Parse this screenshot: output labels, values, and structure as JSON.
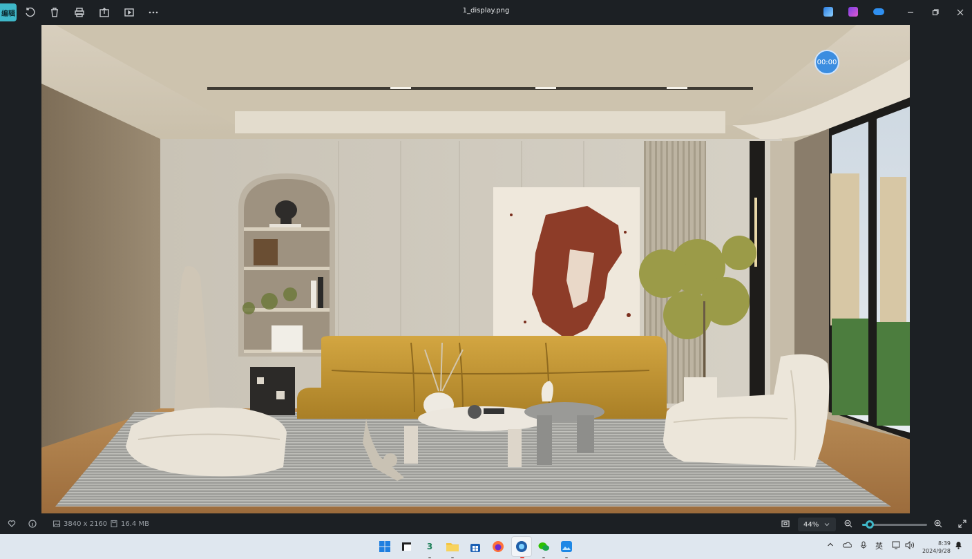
{
  "toolbar": {
    "edit_label": "编辑",
    "file_name": "1_display.png",
    "icons": [
      "rotate-icon",
      "delete-icon",
      "print-icon",
      "share-icon",
      "slideshow-icon",
      "more-icon"
    ],
    "app_icons": [
      "photos-edit-icon",
      "clipchamp-icon",
      "onedrive-icon"
    ]
  },
  "overlay": {
    "timer": "00:00"
  },
  "status_bar": {
    "dimensions": "3840 x 2160",
    "file_size": "16.4 MB",
    "zoom_value": "44%",
    "zoom_fraction": 0.12
  },
  "taskbar": {
    "apps": [
      "windows-start",
      "task-view",
      "app-3",
      "file-explorer",
      "microsoft-store",
      "firefox",
      "active-app",
      "wechat",
      "photos"
    ],
    "tray": {
      "ime": "英",
      "time": "8:39",
      "date": "2024/9/28"
    }
  },
  "colors": {
    "accent": "#3fb8c9",
    "timer_badge": "#3b8de0",
    "sofa": "#c79a34"
  }
}
